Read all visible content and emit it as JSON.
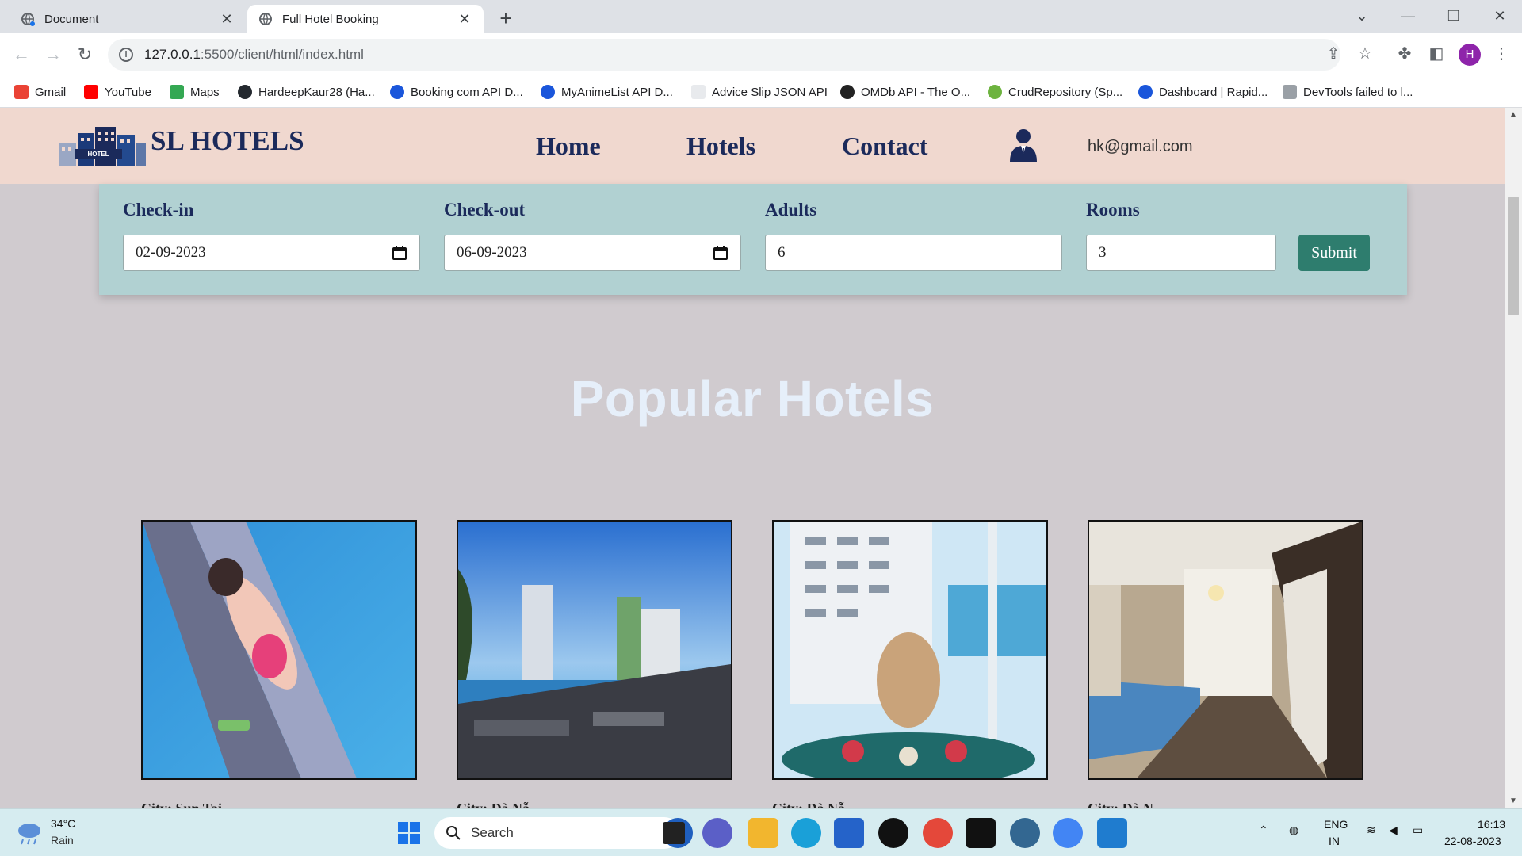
{
  "browser": {
    "tabs": [
      {
        "title": "Document",
        "close": "✕"
      },
      {
        "title": "Full Hotel Booking",
        "close": "✕"
      }
    ],
    "new_tab": "+",
    "window_controls": {
      "dropdown": "⌄",
      "minimize": "—",
      "restore": "❐",
      "close": "✕"
    },
    "nav": {
      "back": "←",
      "forward": "→",
      "reload": "↻"
    },
    "url_host": "127.0.0.1",
    "url_path": ":5500/client/html/index.html",
    "profile_initial": "H",
    "bookmarks": [
      {
        "label": "Gmail",
        "icon": "gmail-icon",
        "color": "#ea4335"
      },
      {
        "label": "YouTube",
        "icon": "youtube-icon",
        "color": "#ff0000"
      },
      {
        "label": "Maps",
        "icon": "maps-icon",
        "color": "#34a853"
      },
      {
        "label": "HardeepKaur28 (Ha...",
        "icon": "github-icon",
        "color": "#24292f"
      },
      {
        "label": "Booking com API D...",
        "icon": "rapidapi-icon",
        "color": "#1a56db"
      },
      {
        "label": "MyAnimeList API D...",
        "icon": "rapidapi-icon",
        "color": "#1a56db"
      },
      {
        "label": "Advice Slip JSON API",
        "icon": "page-icon",
        "color": "#e8eaed"
      },
      {
        "label": "OMDb API - The O...",
        "icon": "film-icon",
        "color": "#222222"
      },
      {
        "label": "CrudRepository (Sp...",
        "icon": "spring-icon",
        "color": "#6db33f"
      },
      {
        "label": "Dashboard | Rapid...",
        "icon": "rapidapi-icon",
        "color": "#1a56db"
      },
      {
        "label": "DevTools failed to l...",
        "icon": "devtools-icon",
        "color": "#9aa0a6"
      }
    ]
  },
  "site": {
    "brand": "SL HOTELS",
    "nav": [
      "Home",
      "Hotels",
      "Contact"
    ],
    "user_email": "hk@gmail.com"
  },
  "booking": {
    "checkin_label": "Check-in",
    "checkin_value": "02-09-2023",
    "checkout_label": "Check-out",
    "checkout_value": "06-09-2023",
    "adults_label": "Adults",
    "adults_value": "6",
    "rooms_label": "Rooms",
    "rooms_value": "3",
    "submit_label": "Submit"
  },
  "popular": {
    "title": "Popular Hotels",
    "hotels": [
      {
        "city": "City: Sun Tai..."
      },
      {
        "city": "City: Đà Nẵ..."
      },
      {
        "city": "City: Đà Nẵ..."
      },
      {
        "city": "City: Đà N..."
      }
    ]
  },
  "taskbar": {
    "temperature": "34°C",
    "condition": "Rain",
    "search_label": "Search",
    "lang_1": "ENG",
    "lang_2": "IN",
    "time": "16:13",
    "date": "22-08-2023"
  },
  "colors": {
    "header_bg": "#f0d8cf",
    "booking_bg": "#b1d1d2",
    "page_bg": "#d0cbcf",
    "brand_navy": "#1b2a5b",
    "submit_green": "#2e7d6e"
  }
}
